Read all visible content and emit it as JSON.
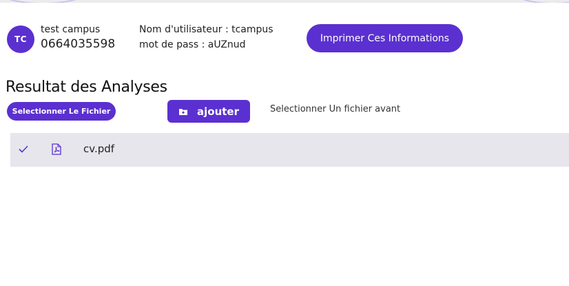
{
  "user": {
    "initials": "TC",
    "name": "test campus",
    "phone": "0664035598",
    "username_line": "Nom d'utilisateur : tcampus",
    "password_line": "mot de pass : aUZnud"
  },
  "actions": {
    "print_label": "Imprimer Ces Informations"
  },
  "analyses": {
    "title": "Resultat des Analyses",
    "select_file_label": "Selectionner Le Fichier",
    "add_label": "ajouter",
    "hint": "Selectionner Un fichier avant"
  },
  "files": [
    {
      "name": "cv.pdf",
      "icon": "pdf-file-icon",
      "status_icon": "check-icon"
    }
  ],
  "colors": {
    "accent": "#5b30d0",
    "row_bg": "#e6e6ec"
  }
}
